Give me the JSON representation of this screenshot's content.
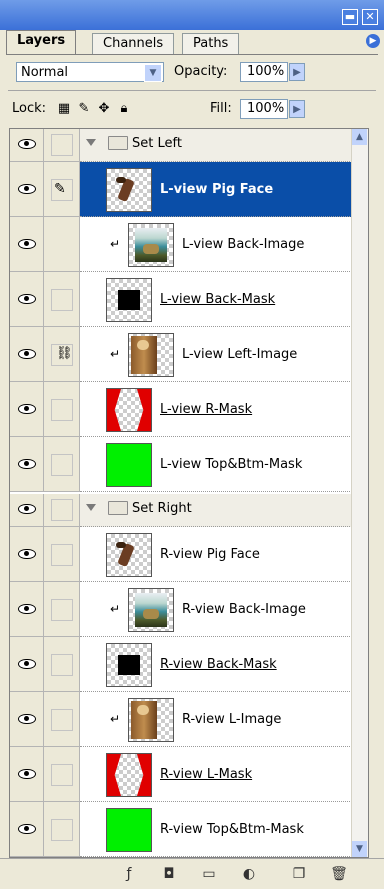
{
  "tabs": [
    {
      "label": "Layers",
      "active": true
    },
    {
      "label": "Channels",
      "active": false
    },
    {
      "label": "Paths",
      "active": false
    }
  ],
  "blend": {
    "mode": "Normal",
    "opacity_label": "Opacity:",
    "opacity_value": "100%"
  },
  "lock": {
    "label": "Lock:",
    "fill_label": "Fill:",
    "fill_value": "100%"
  },
  "layers": [
    {
      "name": "Set Left",
      "type": "group"
    },
    {
      "name": "L-view Pig Face",
      "type": "layer",
      "thumb": "pig",
      "selected": true,
      "brush": true
    },
    {
      "name": "L-view Back-Image",
      "type": "layer",
      "thumb": "photo-back",
      "clipped": true
    },
    {
      "name": "L-view Back-Mask",
      "type": "layer",
      "thumb": "mask-black",
      "underline": true
    },
    {
      "name": "L-view Left-Image",
      "type": "layer",
      "thumb": "photo-pig",
      "clipped": true,
      "linked": true
    },
    {
      "name": "L-view R-Mask",
      "type": "layer",
      "thumb": "mask-red",
      "underline": true
    },
    {
      "name": "L-view Top&Btm-Mask",
      "type": "layer",
      "thumb": "mask-green"
    },
    {
      "name": "Set Right",
      "type": "group"
    },
    {
      "name": "R-view Pig Face",
      "type": "layer",
      "thumb": "pig"
    },
    {
      "name": "R-view Back-Image",
      "type": "layer",
      "thumb": "photo-back",
      "clipped": true
    },
    {
      "name": "R-view Back-Mask",
      "type": "layer",
      "thumb": "mask-black",
      "underline": true
    },
    {
      "name": "R-view L-Image",
      "type": "layer",
      "thumb": "photo-pig",
      "clipped": true
    },
    {
      "name": "R-view L-Mask",
      "type": "layer",
      "thumb": "mask-red",
      "underline": true
    },
    {
      "name": "R-view Top&Btm-Mask",
      "type": "layer",
      "thumb": "mask-green"
    }
  ],
  "icons": {
    "eye": "visibility-eye-icon",
    "link": "chain-link-icon",
    "brush": "paint-brush-icon",
    "clip": "clipping-arrow-icon",
    "folder": "folder-icon"
  },
  "colors": {
    "selection": "#0a4ea8",
    "panel": "#ECE9D8"
  }
}
